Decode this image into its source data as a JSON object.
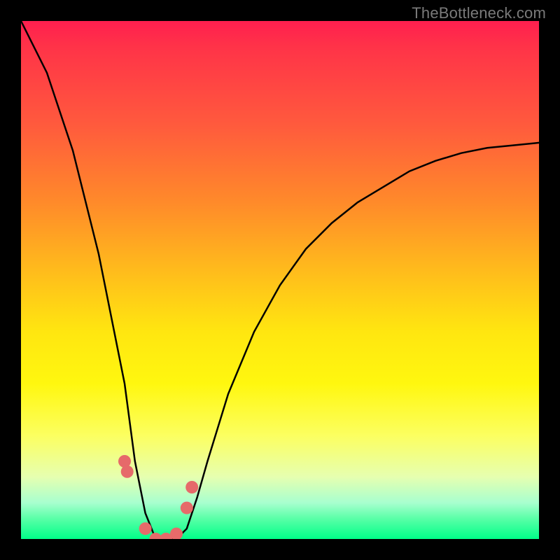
{
  "watermark": "TheBottleneck.com",
  "chart_data": {
    "type": "line",
    "title": "",
    "xlabel": "",
    "ylabel": "",
    "xlim": [
      0,
      100
    ],
    "ylim": [
      0,
      100
    ],
    "series": [
      {
        "name": "bottleneck-curve",
        "x": [
          0,
          5,
          10,
          15,
          20,
          22,
          24,
          26,
          28,
          30,
          32,
          34,
          36,
          40,
          45,
          50,
          55,
          60,
          65,
          70,
          75,
          80,
          85,
          90,
          95,
          100
        ],
        "values": [
          100,
          90,
          75,
          55,
          30,
          15,
          5,
          0,
          0,
          0,
          2,
          8,
          15,
          28,
          40,
          49,
          56,
          61,
          65,
          68,
          71,
          73,
          74.5,
          75.5,
          76,
          76.5
        ]
      },
      {
        "name": "marker-points",
        "x": [
          20,
          20.5,
          24,
          26,
          28,
          30,
          32,
          33
        ],
        "values": [
          15,
          13,
          2,
          0,
          0,
          1,
          6,
          10
        ]
      }
    ],
    "gradient_stops": [
      {
        "pos": 0,
        "color": "#ff1f4f"
      },
      {
        "pos": 20,
        "color": "#ff5a3d"
      },
      {
        "pos": 50,
        "color": "#ffc21a"
      },
      {
        "pos": 70,
        "color": "#fff70f"
      },
      {
        "pos": 88,
        "color": "#e6ffb0"
      },
      {
        "pos": 100,
        "color": "#00ff88"
      }
    ],
    "marker_color": "#e66a6a",
    "curve_color": "#000000"
  }
}
